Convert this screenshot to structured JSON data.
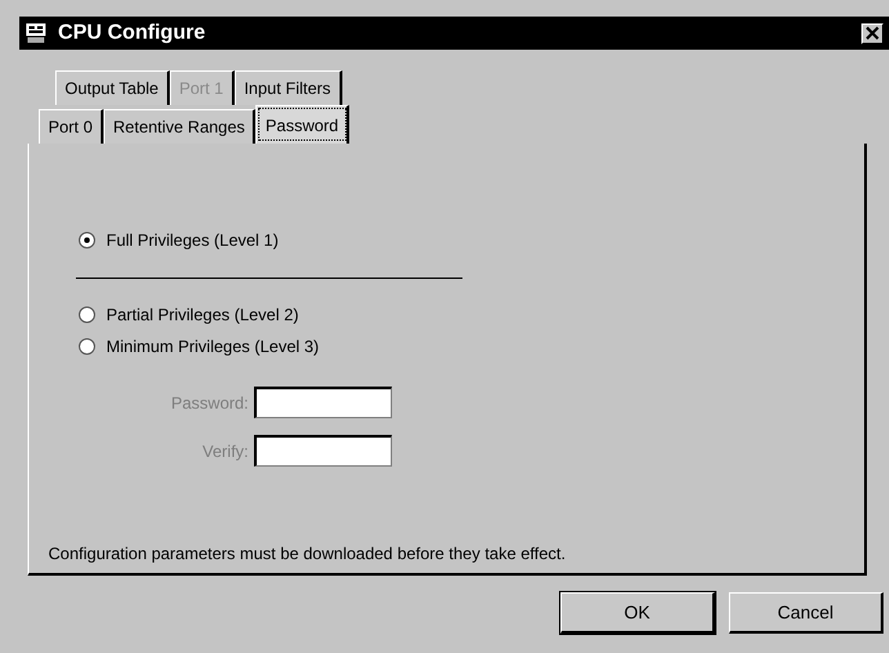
{
  "window": {
    "title": "CPU Configure"
  },
  "tab_rows": [
    [
      {
        "label": "Output Table",
        "selected": false,
        "disabled": false
      },
      {
        "label": "Port 1",
        "selected": false,
        "disabled": true
      },
      {
        "label": "Input Filters",
        "selected": false,
        "disabled": false
      }
    ],
    [
      {
        "label": "Port 0",
        "selected": false,
        "disabled": false
      },
      {
        "label": "Retentive Ranges",
        "selected": false,
        "disabled": false
      },
      {
        "label": "Password",
        "selected": true,
        "disabled": false
      }
    ]
  ],
  "privileges": [
    {
      "label": "Full Privileges (Level 1)",
      "selected": true
    },
    {
      "label": "Partial Privileges (Level 2)",
      "selected": false
    },
    {
      "label": "Minimum Privileges (Level 3)",
      "selected": false
    }
  ],
  "fields": [
    {
      "label": "Password:",
      "disabled": true
    },
    {
      "label": "Verify:",
      "disabled": true
    }
  ],
  "note": "Configuration parameters must be downloaded before they take effect.",
  "buttons": [
    {
      "label": "OK",
      "default": true
    },
    {
      "label": "Cancel",
      "default": false
    }
  ]
}
